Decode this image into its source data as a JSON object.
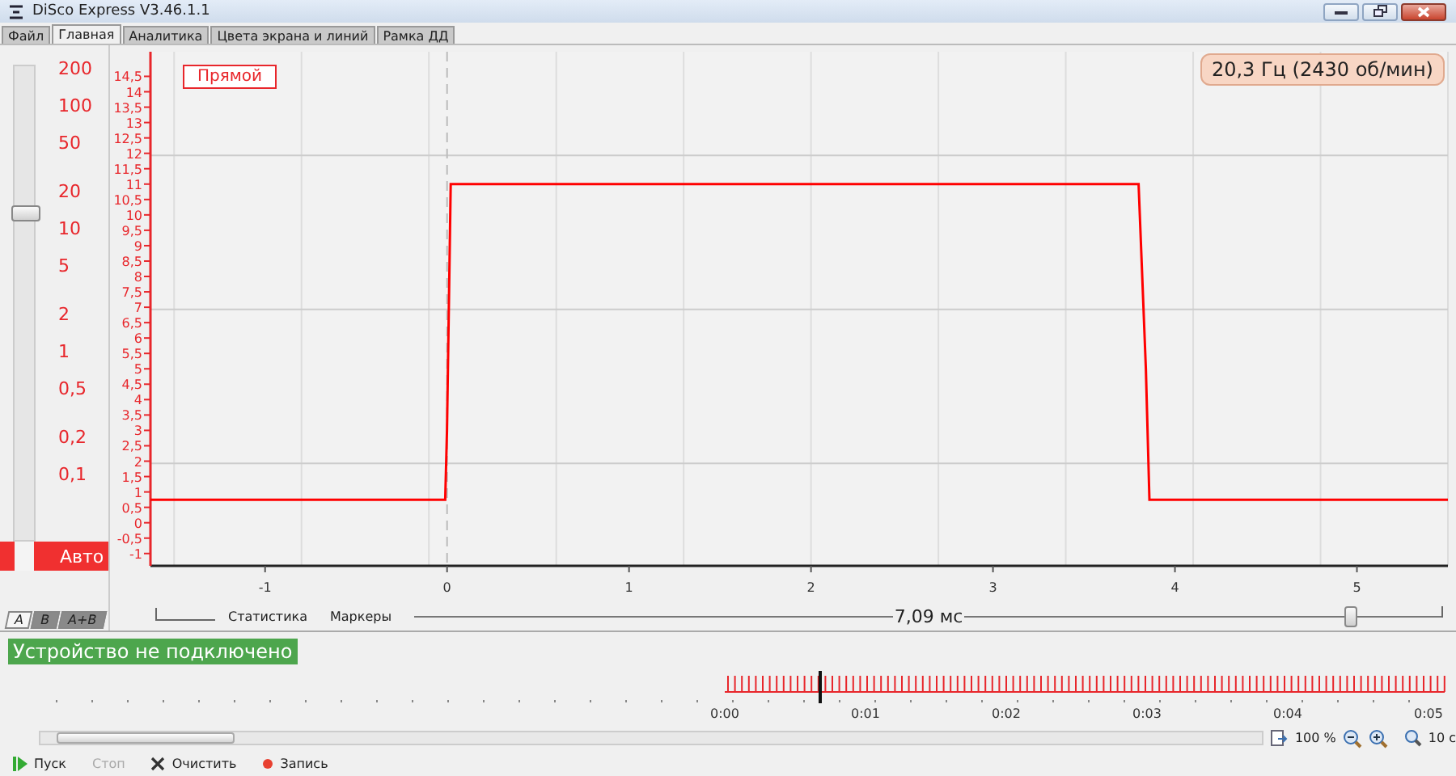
{
  "window": {
    "title": "DiSco Express V3.46.1.1"
  },
  "tabs": [
    {
      "label": "Файл",
      "selected": false
    },
    {
      "label": "Главная",
      "selected": true
    },
    {
      "label": "Аналитика",
      "selected": false
    },
    {
      "label": "Цвета экрана и линий",
      "selected": false
    },
    {
      "label": "Рамка ДД",
      "selected": false
    }
  ],
  "gain_scale": {
    "labels": [
      "200",
      "100",
      "50",
      "20",
      "10",
      "5",
      "2",
      "1",
      "0,5",
      "0,2",
      "0,1"
    ],
    "auto_label": "Авто",
    "level": 0.7
  },
  "channel_tabs": [
    {
      "label": "A",
      "selected": true
    },
    {
      "label": "B",
      "selected": false
    },
    {
      "label": "A+B",
      "selected": false
    }
  ],
  "plot": {
    "mode_label": "Прямой",
    "frequency": "20,3 Гц (2430 об/мин)",
    "chart_data": {
      "type": "line",
      "grid": true,
      "ref_lines": [
        {
          "axis": "x",
          "value": 0
        }
      ],
      "xlim": [
        -1.63,
        5.5
      ],
      "ylim": [
        -1.4,
        15.3
      ],
      "xticks": [
        -1,
        0,
        1,
        2,
        3,
        4,
        5
      ],
      "yticks": [
        {
          "value": -1,
          "label": "-1"
        },
        {
          "value": -0.5,
          "label": "-0,5"
        },
        {
          "value": 0,
          "label": "0"
        },
        {
          "value": 0.5,
          "label": "0,5"
        },
        {
          "value": 1,
          "label": "1"
        },
        {
          "value": 1.5,
          "label": "1,5"
        },
        {
          "value": 2,
          "label": "2"
        },
        {
          "value": 2.5,
          "label": "2,5"
        },
        {
          "value": 3,
          "label": "3"
        },
        {
          "value": 3.5,
          "label": "3,5"
        },
        {
          "value": 4,
          "label": "4"
        },
        {
          "value": 4.5,
          "label": "4,5"
        },
        {
          "value": 5,
          "label": "5"
        },
        {
          "value": 5.5,
          "label": "5,5"
        },
        {
          "value": 6,
          "label": "6"
        },
        {
          "value": 6.5,
          "label": "6,5"
        },
        {
          "value": 7,
          "label": "7"
        },
        {
          "value": 7.5,
          "label": "7,5"
        },
        {
          "value": 8,
          "label": "8"
        },
        {
          "value": 8.5,
          "label": "8,5"
        },
        {
          "value": 9,
          "label": "9"
        },
        {
          "value": 9.5,
          "label": "9,5"
        },
        {
          "value": 10,
          "label": "10"
        },
        {
          "value": 10.5,
          "label": "10,5"
        },
        {
          "value": 11,
          "label": "11"
        },
        {
          "value": 11.5,
          "label": "11,5"
        },
        {
          "value": 12,
          "label": "12"
        },
        {
          "value": 12.5,
          "label": "12,5"
        },
        {
          "value": 13,
          "label": "13"
        },
        {
          "value": 13.5,
          "label": "13,5"
        },
        {
          "value": 14,
          "label": "14"
        },
        {
          "value": 14.5,
          "label": "14,5"
        }
      ],
      "x": [
        -1.63,
        -0.01,
        0.0,
        0.02,
        3.8,
        3.84,
        3.86,
        5.5
      ],
      "series": [
        {
          "color": "#ff0000",
          "values": [
            0.75,
            0.75,
            3.0,
            11.0,
            11.0,
            5.0,
            0.75,
            0.75
          ]
        }
      ]
    }
  },
  "plot_footer": {
    "tabs": [
      "Статистика",
      "Маркеры"
    ],
    "sweep": "7,09 мс",
    "level": 0.91
  },
  "status": {
    "text": "Устройство не подключено"
  },
  "timeline": {
    "labels": [
      "0:00",
      "0:01",
      "0:02",
      "0:03",
      "0:04",
      "0:05"
    ]
  },
  "zoom": {
    "percent": "100 %",
    "span": "10 с"
  },
  "toolbar": [
    {
      "label": "Пуск",
      "kind": "play",
      "disabled": false
    },
    {
      "label": "Стоп",
      "kind": "stop",
      "disabled": true
    },
    {
      "label": "Очистить",
      "kind": "clear",
      "disabled": false
    },
    {
      "label": "Запись",
      "kind": "record",
      "disabled": false
    }
  ]
}
